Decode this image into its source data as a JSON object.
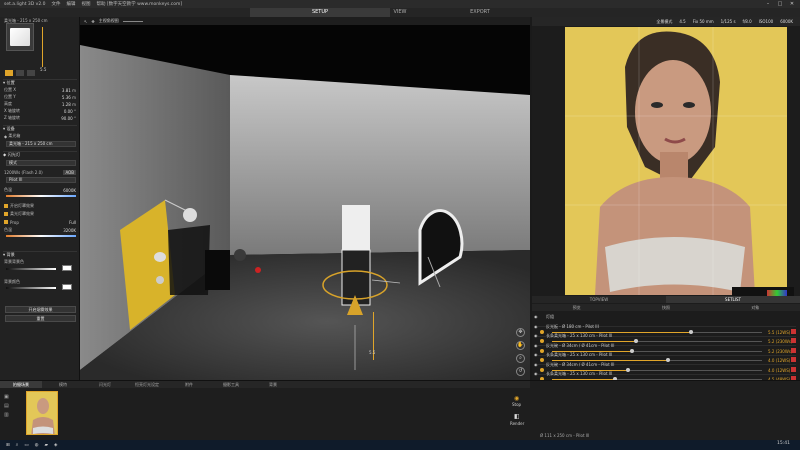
{
  "app": {
    "title": "set.a.light 3D v2.0",
    "menu": [
      "文件",
      "编辑",
      "视图",
      "帮助 [数字天空教学 www.monkeys.com]"
    ]
  },
  "modes": [
    {
      "label": "SETUP",
      "active": true
    },
    {
      "label": "VIEW",
      "active": false
    },
    {
      "label": "EXPORT",
      "active": false
    }
  ],
  "left": {
    "object_name": "柔光箱 - 215 x 250 cm",
    "slider_value": "5.5",
    "position_section": "位置",
    "fields": [
      {
        "label": "位置 X",
        "value": "3.81",
        "unit": "m"
      },
      {
        "label": "位置 Y",
        "value": "5.36",
        "unit": "m"
      },
      {
        "label": "高度",
        "value": "1.28",
        "unit": "m"
      },
      {
        "label": "X 轴旋转",
        "value": "0.00",
        "unit": "°"
      },
      {
        "label": "Z 轴旋转",
        "value": "90.00",
        "unit": "°"
      }
    ],
    "equipment_section": "设备",
    "equipment_sub": "柔光箱",
    "equipment_value": "柔光箱 - 215 x 250 cm",
    "flash_section": "闪光灯",
    "flash_type": "模式",
    "flash_model": "1200Ws (Flash 2.0)",
    "flash_badge": "AOB",
    "flash_head": "Pilot III",
    "temp_label": "色温",
    "temp_value": "6000K",
    "checkbox_1": "开启灯罩效果",
    "checkbox_2": "柔光灯罩效果",
    "option_left": "Prop",
    "option_right": "Full",
    "temp2_label": "色温",
    "temp2_value": "3200K",
    "background_section": "背景",
    "background_label": "背景背景色",
    "background_label2": "背景颜色",
    "btn_fog": "开启烟雾效果",
    "btn_reset": "重置"
  },
  "viewport": {
    "toolbar": [
      "主视角视图",
      "1.0"
    ],
    "slider_label": "5.5"
  },
  "camera_toolbar": {
    "items": [
      "全景模式",
      "4.5",
      "Fix 50 mm",
      "1/125 s",
      "f/8.0",
      "ISO100",
      "6000K"
    ]
  },
  "right_tabs": [
    {
      "label": "TOPVIEW",
      "active": false
    },
    {
      "label": "SETLIST",
      "active": true
    }
  ],
  "right_subtabs": [
    "预览",
    "快照",
    "对象"
  ],
  "lights": [
    {
      "name": "灯组",
      "value": "",
      "fill": 0
    },
    {
      "name": "反光板 - Ø 180 cm - Pilot III",
      "value": "5.5 (12WS)",
      "fill": 0.66
    },
    {
      "name": "长条柔光箱 - 25 x 130 cm - Pilot III",
      "value": "5.2 (230Ws)",
      "fill": 0.4
    },
    {
      "name": "反光碗 - Ø 34cm / Ø 41cm - Pilot III",
      "value": "5.2 (230Ws)",
      "fill": 0.38
    },
    {
      "name": "长条柔光箱 - 25 x 130 cm - Pilot III",
      "value": "4.0 (12WS)",
      "fill": 0.55
    },
    {
      "name": "反光碗 - Ø 34cm / Ø 41cm - Pilot III",
      "value": "4.0 (12WS)",
      "fill": 0.36
    },
    {
      "name": "长条柔光箱 - 25 x 130 cm - Pilot III",
      "value": "4.5 (48WS)",
      "fill": 0.3
    }
  ],
  "bottom": {
    "tabs": [
      {
        "label": "拍摄场景",
        "active": true
      },
      {
        "label": "模特",
        "active": false
      },
      {
        "label": "闪光灯",
        "active": false
      },
      {
        "label": "恒亮灯光设定",
        "active": false
      },
      {
        "label": "附件",
        "active": false
      },
      {
        "label": "摄影工具",
        "active": false
      },
      {
        "label": "背景",
        "active": false
      }
    ],
    "stop_label": "Stop",
    "render_label": "Render",
    "status": "Ø 111 x 250 cm - Pilot III"
  },
  "taskbar": {
    "clock": "15:41"
  },
  "colors": {
    "accent": "#e0a52a",
    "backdrop": "#e3c758"
  }
}
